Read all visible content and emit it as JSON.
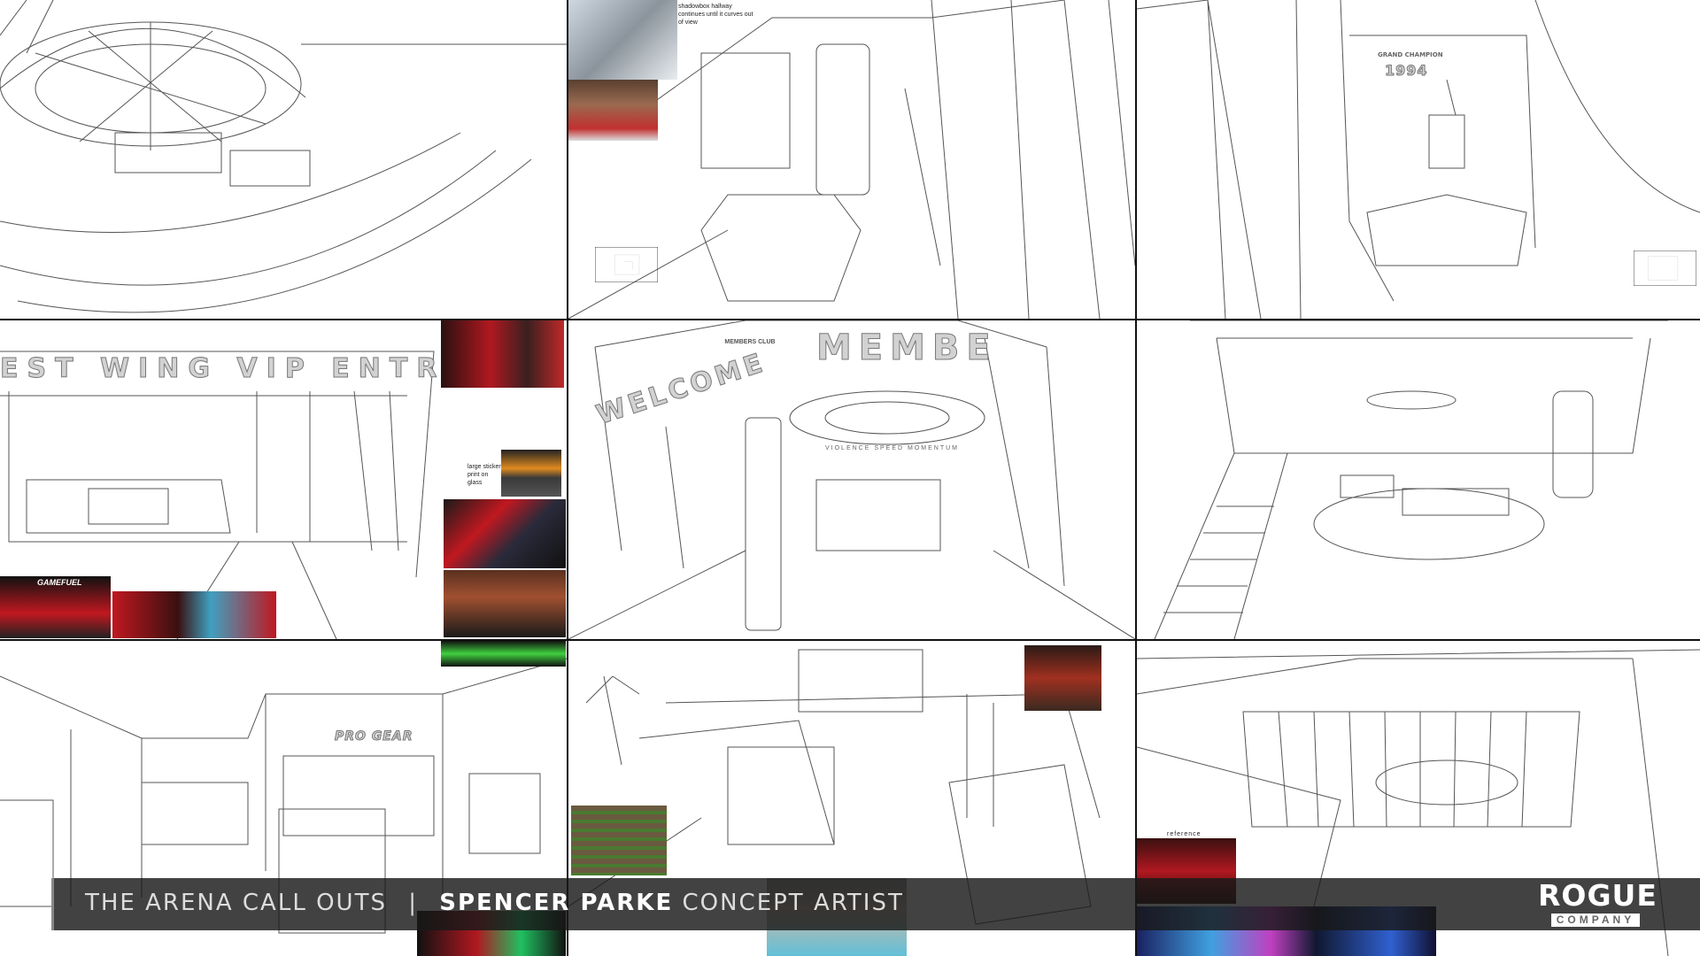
{
  "banner": {
    "title": "THE ARENA CALL OUTS",
    "separator": "|",
    "artist_name": "SPENCER PARKE",
    "artist_role": "CONCEPT ARTIST"
  },
  "logo": {
    "main": "ROGUE",
    "sub": "COMPANY"
  },
  "panels": {
    "hallway_note": "shadowbox hallway continues until it curves out of view",
    "champion_sign_title": "GRAND CHAMPION",
    "champion_sign_year": "1994",
    "vip_sign": "EST WING VIP ENTRANCE",
    "sticker_note": "large sticker print on glass",
    "gamefuel_label": "GAMEFUEL",
    "welcome_sign": "WELCOME",
    "members_sign": "MEMBE",
    "club_badge": "MEMBERS CLUB",
    "ring_text": "VIOLENCE SPEED MOMENTUM",
    "pro_gear_sign": "PRO GEAR",
    "reference_label": "reference"
  },
  "colors": {
    "banner_bg": "#191919",
    "accent_red": "#b3141b",
    "grid_line": "#111111"
  }
}
